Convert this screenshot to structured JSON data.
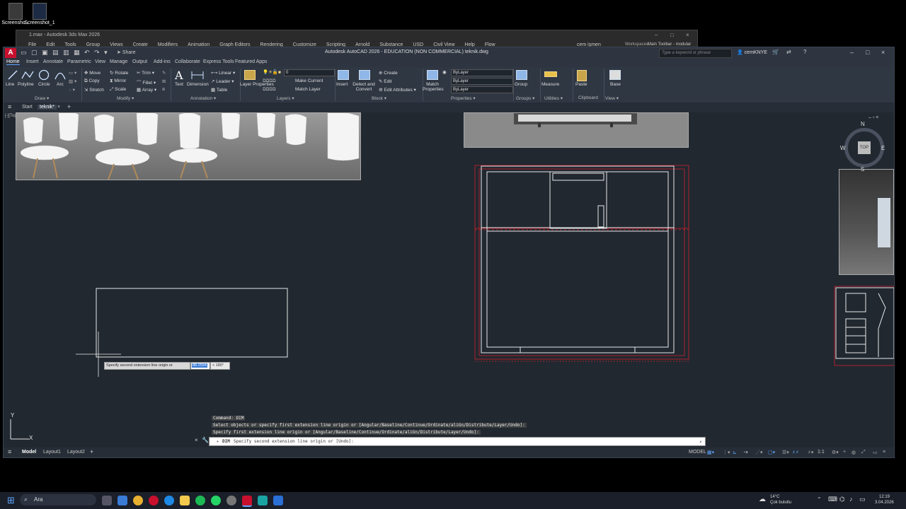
{
  "desktop": {
    "icons": [
      {
        "label": "Screensho..."
      },
      {
        "label": "Screenshot_1"
      }
    ]
  },
  "max_window": {
    "title": "1.max - Autodesk 3ds Max 2026",
    "menu": [
      "File",
      "Edit",
      "Tools",
      "Group",
      "Views",
      "Create",
      "Modifiers",
      "Animation",
      "Graph Editors",
      "Rendering",
      "Customize",
      "Scripting",
      "Arnold",
      "Substance",
      "USD",
      "Civil View",
      "Help",
      "Flow"
    ],
    "user": "cem işmen",
    "workspaces_label": "Workspaces:",
    "workspace_value": "Main Toolbar - modular"
  },
  "acad": {
    "logo": "A",
    "share": "Share",
    "title": "Autodesk AutoCAD 2026 - EDUCATION (NON COMMERCIAL)    teknik.dwg",
    "search_placeholder": "Type a keyword or phrase",
    "user": "cemKNYE",
    "ribbon_tabs": [
      "Home",
      "Insert",
      "Annotate",
      "Parametric",
      "View",
      "Manage",
      "Output",
      "Add-ins",
      "Collaborate",
      "Express Tools",
      "Featured Apps"
    ],
    "draw": {
      "line": "Line",
      "polyline": "Polyline",
      "circle": "Circle",
      "arc": "Arc",
      "panel": "Draw ▾"
    },
    "modify": {
      "move": "Move",
      "rotate": "Rotate",
      "trim": "Trim ▾",
      "copy": "Copy",
      "mirror": "Mirror",
      "fillet": "Fillet ▾",
      "stretch": "Stretch",
      "scale": "Scale",
      "array": "Array ▾",
      "panel": "Modify ▾"
    },
    "annotation": {
      "text": "Text",
      "dimension": "Dimension",
      "linear": "Linear ▾",
      "leader": "Leader ▾",
      "table": "Table",
      "panel": "Annotation ▾"
    },
    "layers": {
      "properties": "Layer Properties",
      "current_layer": "0",
      "make_current": "Make Current",
      "match_layer": "Match Layer",
      "panel": "Layers ▾"
    },
    "block": {
      "insert": "Insert",
      "detect": "Detect and Convert",
      "create": "Create",
      "edit": "Edit",
      "attributes": "Edit Attributes ▾",
      "panel": "Block ▾"
    },
    "properties": {
      "match": "Match Properties",
      "bylayer1": "ByLayer",
      "bylayer2": "ByLayer",
      "bylayer3": "ByLayer",
      "panel": "Properties ▾"
    },
    "groups": {
      "group": "Group",
      "panel": "Groups ▾"
    },
    "utilities": {
      "measure": "Measure",
      "panel": "Utilities ▾"
    },
    "clipboard": {
      "paste": "Paste",
      "panel": "Clipboard"
    },
    "view": {
      "base": "Base",
      "panel": "View ▾"
    },
    "file_tabs": {
      "start": "Start",
      "current": "teknik*",
      "close": "×",
      "add": "+"
    },
    "viewport_label": "[-][Top][2D Wireframe]",
    "viewcube": {
      "n": "N",
      "s": "S",
      "e": "E",
      "w": "W",
      "top": "TOP"
    },
    "axis": {
      "x": "X",
      "y": "Y"
    },
    "tooltip": {
      "prompt": "Specify second extension line origin or",
      "value": "88.2594",
      "angle": "< 180°"
    },
    "cmd_history": [
      "Command: DIM",
      "Select objects or specify first extension line origin or [Angular/Baseline/Continue/Ordinate/aliGn/Distribute/Layer/Undo]:",
      "Specify first extension line origin or [Angular/Baseline/Continue/Ordinate/aliGn/Distribute/Layer/Undo]:"
    ],
    "cmd_prefix": "DIM",
    "cmd_current": "Specify second extension line origin or [Undo]:",
    "status_tabs": {
      "model": "Model",
      "layout1": "Layout1",
      "layout2": "Layout2",
      "add": "+"
    },
    "status_model": "MODEL",
    "status_scale": "1:1"
  },
  "taskbar": {
    "search": "Ara",
    "weather_temp": "14°C",
    "weather_desc": "Çok bulutlu",
    "time": "12:19",
    "date": "3.04.2026"
  },
  "colors": {
    "canvas": "#212830",
    "red_dims": "#d0212b",
    "accent": "#5fa5ff"
  }
}
